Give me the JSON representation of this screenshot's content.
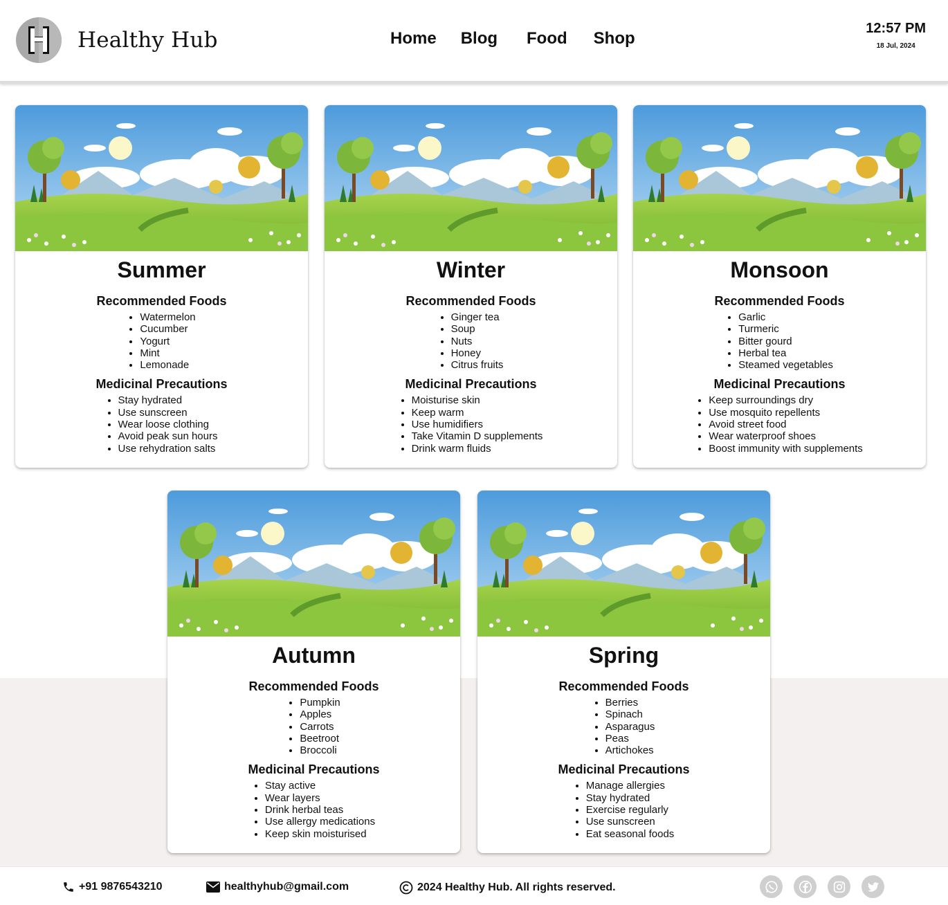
{
  "header": {
    "brand": "Healthy Hub",
    "logo_letter": "H",
    "nav": [
      "Home",
      "Blog",
      "Food",
      "Shop"
    ],
    "time": "12:57 PM",
    "date": "18 Jul, 2024"
  },
  "sections": {
    "recommended_heading": "Recommended Foods",
    "precautions_heading": "Medicinal Precautions"
  },
  "seasons": [
    {
      "name": "Summer",
      "foods": [
        "Watermelon",
        "Cucumber",
        "Yogurt",
        "Mint",
        "Lemonade"
      ],
      "precautions": [
        "Stay hydrated",
        "Use sunscreen",
        "Wear loose clothing",
        "Avoid peak sun hours",
        "Use rehydration salts"
      ]
    },
    {
      "name": "Winter",
      "foods": [
        "Ginger tea",
        "Soup",
        "Nuts",
        "Honey",
        "Citrus fruits"
      ],
      "precautions": [
        "Moisturise skin",
        "Keep warm",
        "Use humidifiers",
        "Take Vitamin D supplements",
        "Drink warm fluids"
      ]
    },
    {
      "name": "Monsoon",
      "foods": [
        "Garlic",
        "Turmeric",
        "Bitter gourd",
        "Herbal tea",
        "Steamed vegetables"
      ],
      "precautions": [
        "Keep surroundings dry",
        "Use mosquito repellents",
        "Avoid street food",
        "Wear waterproof shoes",
        "Boost immunity with supplements"
      ]
    },
    {
      "name": "Autumn",
      "foods": [
        "Pumpkin",
        "Apples",
        "Carrots",
        "Beetroot",
        "Broccoli"
      ],
      "precautions": [
        "Stay active",
        "Wear layers",
        "Drink herbal teas",
        "Use allergy medications",
        "Keep skin moisturised"
      ]
    },
    {
      "name": "Spring",
      "foods": [
        "Berries",
        "Spinach",
        "Asparagus",
        "Peas",
        "Artichokes"
      ],
      "precautions": [
        "Manage allergies",
        "Stay hydrated",
        "Exercise regularly",
        "Use sunscreen",
        "Eat seasonal foods"
      ]
    }
  ],
  "footer": {
    "phone": "+91 9876543210",
    "email": "healthyhub@gmail.com",
    "copyright": "2024 Healthy Hub. All rights reserved.",
    "socials": [
      "whatsapp-icon",
      "facebook-icon",
      "instagram-icon",
      "twitter-icon"
    ]
  },
  "colors": {
    "sky": "#5aa7e0",
    "grass": "#8cc63f",
    "footer_bg": "#f4f0ef",
    "social_gray": "#cfcfcf"
  }
}
